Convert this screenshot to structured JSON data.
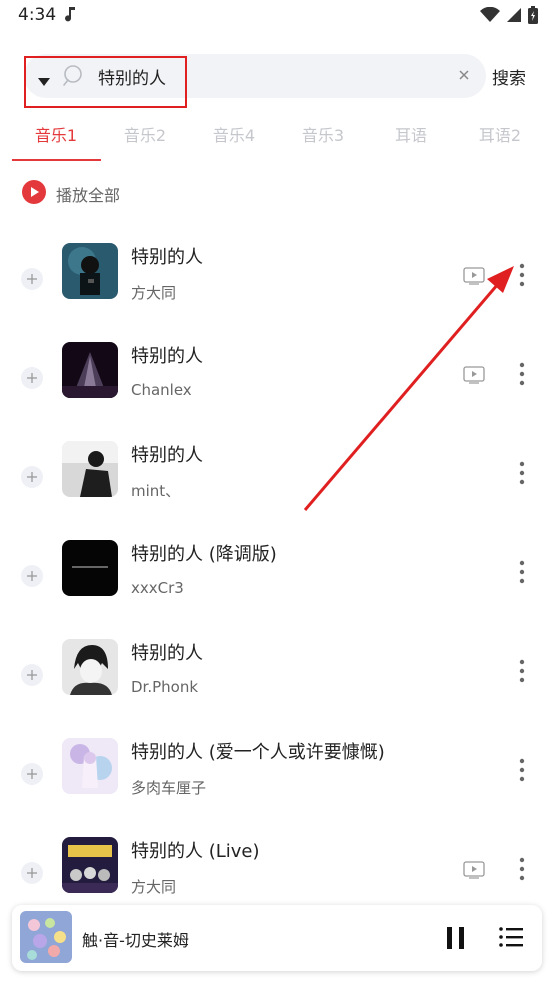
{
  "status_bar": {
    "time": "4:34"
  },
  "search": {
    "query": "特别的人",
    "button_label": "搜索"
  },
  "tabs": [
    {
      "label": "音乐1",
      "active": true
    },
    {
      "label": "音乐2",
      "active": false
    },
    {
      "label": "音乐4",
      "active": false
    },
    {
      "label": "音乐3",
      "active": false
    },
    {
      "label": "耳语",
      "active": false
    },
    {
      "label": "耳语2",
      "active": false
    }
  ],
  "play_all": {
    "label": "播放全部"
  },
  "songs": [
    {
      "title": "特别的人",
      "artist": "方大同",
      "has_mv": true
    },
    {
      "title": "特别的人",
      "artist": "Chanlex",
      "has_mv": true
    },
    {
      "title": "特别的人",
      "artist": "mint、",
      "has_mv": false
    },
    {
      "title": "特别的人 (降调版)",
      "artist": "xxxCr3",
      "has_mv": false
    },
    {
      "title": "特别的人",
      "artist": "Dr.Phonk",
      "has_mv": false
    },
    {
      "title": "特别的人 (爱一个人或许要慷慨)",
      "artist": "多肉车厘子",
      "has_mv": false
    },
    {
      "title": "特别的人 (Live)",
      "artist": "方大同",
      "has_mv": true
    }
  ],
  "player": {
    "title": "触·音-切史莱姆"
  },
  "colors": {
    "accent": "#e4393c",
    "annotation": "#e02020"
  }
}
